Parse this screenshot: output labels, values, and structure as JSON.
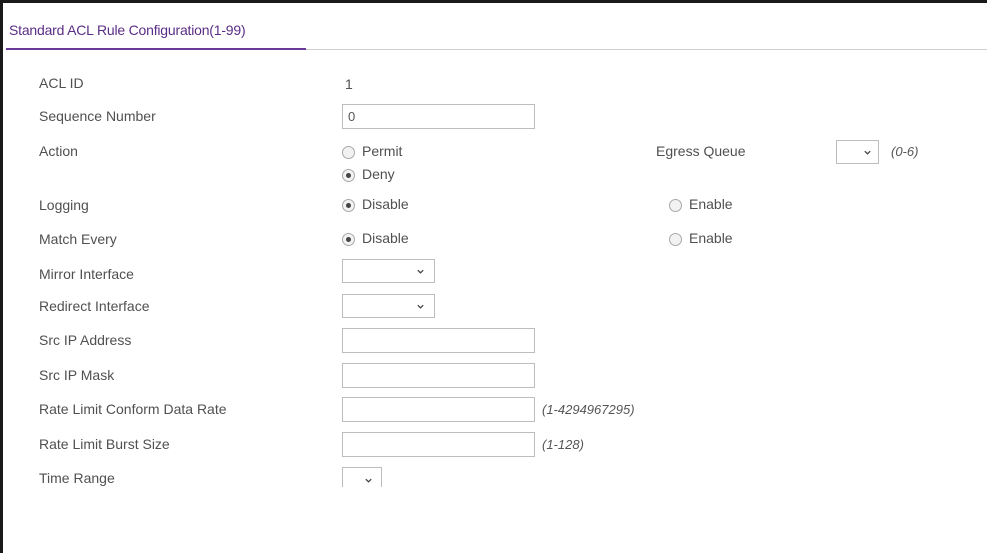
{
  "section": {
    "title": "Standard ACL Rule Configuration(1-99)"
  },
  "fields": {
    "acl_id": {
      "label": "ACL ID",
      "value": "1"
    },
    "sequence_number": {
      "label": "Sequence Number",
      "value": "0"
    },
    "action": {
      "label": "Action",
      "options": [
        "Permit",
        "Deny"
      ],
      "selected": "Deny"
    },
    "egress_queue": {
      "label": "Egress Queue",
      "value": "",
      "hint": "(0-6)"
    },
    "logging": {
      "label": "Logging",
      "options": [
        "Disable",
        "Enable"
      ],
      "selected": "Disable"
    },
    "match_every": {
      "label": "Match Every",
      "options": [
        "Disable",
        "Enable"
      ],
      "selected": "Disable"
    },
    "mirror_interface": {
      "label": "Mirror Interface",
      "value": ""
    },
    "redirect_interface": {
      "label": "Redirect Interface",
      "value": ""
    },
    "src_ip_address": {
      "label": "Src IP Address",
      "value": ""
    },
    "src_ip_mask": {
      "label": "Src IP Mask",
      "value": ""
    },
    "rate_limit_conform": {
      "label": "Rate Limit Conform Data Rate",
      "value": "",
      "hint": "(1-4294967295)"
    },
    "rate_limit_burst": {
      "label": "Rate Limit Burst Size",
      "value": "",
      "hint": "(1-128)"
    },
    "time_range": {
      "label": "Time Range",
      "value": ""
    }
  },
  "icons": {
    "dropdown": "chevron-down-icon"
  },
  "colors": {
    "title": "#5b2d86",
    "underline": "#6a3a9a",
    "border": "#bdbdbd"
  }
}
